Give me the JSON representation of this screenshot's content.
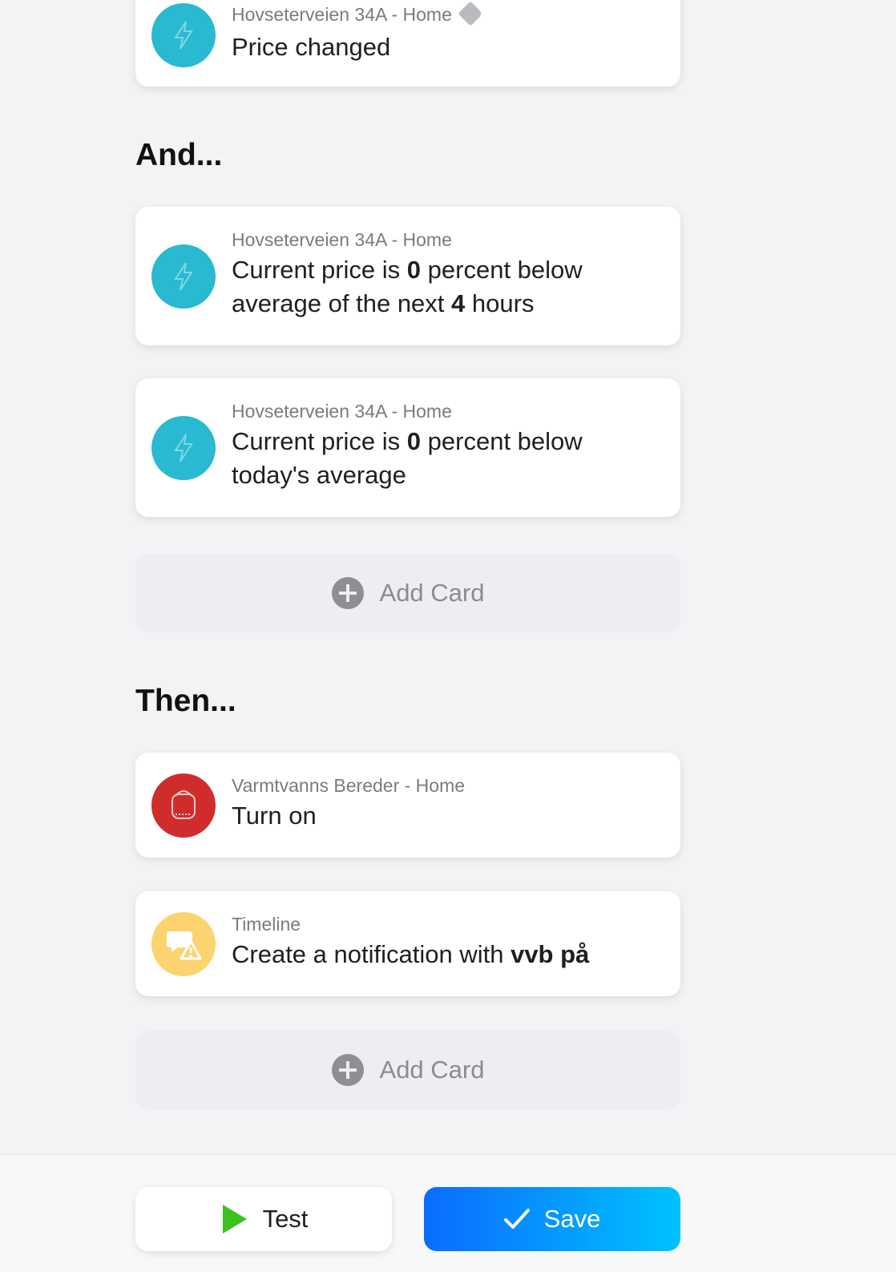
{
  "colors": {
    "lightning": "#29b9d1",
    "device_red": "#d12c2c",
    "timeline_yellow": "#fcd36e",
    "save_gradient_start": "#0a6cff",
    "save_gradient_end": "#00c2ff",
    "test_play": "#3cc21f"
  },
  "when_card": {
    "subtitle": "Hovseterveien 34A - Home",
    "title": "Price changed",
    "icon": "lightning-icon",
    "tag_icon": "tag-icon"
  },
  "and_section": {
    "heading": "And...",
    "cards": [
      {
        "subtitle": "Hovseterveien 34A - Home",
        "parts": [
          "Current price is ",
          "0",
          " percent below average of the next ",
          "4",
          " hours"
        ],
        "icon": "lightning-icon"
      },
      {
        "subtitle": "Hovseterveien 34A - Home",
        "parts": [
          "Current price is ",
          "0",
          " percent below today's average"
        ],
        "icon": "lightning-icon"
      }
    ],
    "add_card": "Add Card"
  },
  "then_section": {
    "heading": "Then...",
    "cards": [
      {
        "subtitle": "Varmtvanns Bereder - Home",
        "title": "Turn on",
        "icon": "water-heater-icon"
      },
      {
        "subtitle": "Timeline",
        "parts": [
          "Create a notification with ",
          "vvb på"
        ],
        "icon": "notification-icon"
      }
    ],
    "add_card": "Add Card"
  },
  "footer": {
    "test_label": "Test",
    "save_label": "Save"
  }
}
